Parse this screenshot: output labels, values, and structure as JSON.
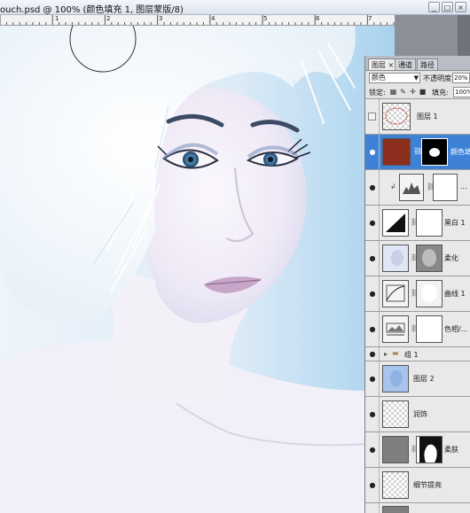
{
  "window": {
    "title": "ouch.psd @ 100% (颜色填充 1, 图层蒙版/8)",
    "buttons": [
      "_",
      "□",
      "×"
    ]
  },
  "ruler": {
    "labels": [
      "1",
      "2",
      "3",
      "4",
      "5",
      "6",
      "7",
      "8"
    ]
  },
  "panel": {
    "tabs": [
      "图层 ×",
      "通道",
      "路径"
    ],
    "blend_mode": "颜色",
    "opacity_label": "不透明度:",
    "opacity_value": "20%",
    "lock_label": "锁定:",
    "fill_label": "填充:",
    "fill_value": "100%",
    "layers": [
      {
        "name": "图层 1",
        "visible": false
      },
      {
        "name": "颜色填...",
        "visible": true,
        "selected": true
      },
      {
        "name": "...",
        "visible": true
      },
      {
        "name": "黑白 1",
        "visible": true
      },
      {
        "name": "柔化",
        "visible": true
      },
      {
        "name": "曲线 1",
        "visible": true
      },
      {
        "name": "色相/...",
        "visible": true
      },
      {
        "name": "组 1",
        "visible": true
      },
      {
        "name": "图层 2",
        "visible": true
      },
      {
        "name": "润饰",
        "visible": true
      },
      {
        "name": "柔肤",
        "visible": true
      },
      {
        "name": "细节提亮",
        "visible": true
      }
    ]
  },
  "icons": {
    "eye": "eye-icon",
    "chain": "chain-link-icon",
    "folder": "folder-icon",
    "triangle": "expand-triangle-icon"
  },
  "colors": {
    "selected_layer": "#3d82d6",
    "fill_color_thumb": "#8b2e1e"
  }
}
